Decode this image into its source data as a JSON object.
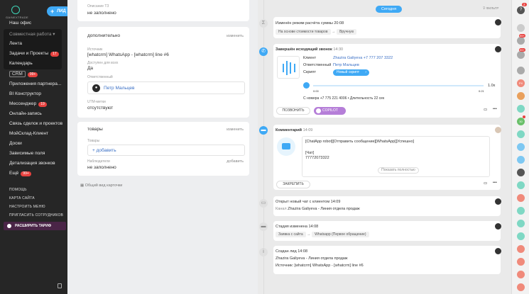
{
  "sidebar": {
    "brand": "GAINEXTRADE",
    "lead_button": "ЛИД",
    "collapse_icon": "collapse-icon",
    "items": [
      {
        "label": "Наш офис"
      },
      {
        "label": "Совместная работа",
        "badge": ""
      },
      {
        "label": "Лента"
      },
      {
        "label": "Задачи и Проекты",
        "badge": "17"
      },
      {
        "label": "Календарь"
      },
      {
        "label": "CRM",
        "badge": "99+"
      },
      {
        "label": "Приложения партнера..."
      },
      {
        "label": "BI Конструктор"
      },
      {
        "label": "Мессенджер",
        "badge": "19"
      },
      {
        "label": "Онлайн-запись"
      },
      {
        "label": "Связь сделок и проектов"
      },
      {
        "label": "МойСклад-Клиент"
      },
      {
        "label": "Доски"
      },
      {
        "label": "Зависимые поля"
      },
      {
        "label": "Детализация звонков"
      },
      {
        "label": "Ещё",
        "badge": "99+"
      }
    ],
    "small_links": [
      "ПОМОЩЬ",
      "КАРТА САЙТА",
      "НАСТРОИТЬ МЕНЮ",
      "ПРИГЛАСИТЬ СОТРУДНИКОВ"
    ],
    "tariff": "РАСШИРИТЬ ТАРИФ"
  },
  "left": {
    "tz_label": "Описание ТЗ",
    "tz_value": "не заполнено",
    "additional": "дополнительно",
    "change": "изменить",
    "source_label": "Источник",
    "source_value": "[whatcrm] WhatsApp - [whatcrm] line #6",
    "available_label": "Доступен для всех",
    "available_value": "Да",
    "responsible_label": "Ответственный",
    "responsible_name": "Петр Мальцев",
    "utm_label": "UTM-метки",
    "utm_value": "отсутствуют",
    "goods": "товары",
    "goods_change": "изменить",
    "goods_label": "Товары",
    "goods_add": "+ добавить",
    "observers_label": "Наблюдатели",
    "observers_add": "добавить",
    "observers_value": "не заполнено",
    "shared_view": "Общий вид карточки"
  },
  "feed": {
    "today": "Сегодня",
    "filter": "ФИЛЬТР",
    "e1": {
      "title": "Изменён режим расчёта суммы",
      "time": "20:08",
      "from": "На основе стоимости товаров",
      "to": "Вручную"
    },
    "call": {
      "title": "Завершён исходящий звонок",
      "time": "14:30",
      "client_label": "Клиент",
      "client_value": "Zhazira Galiyeva +7 777 207 3322",
      "responsible_label": "Ответственный",
      "responsible_value": "Петр Мальцев",
      "script_label": "Скрипт",
      "script_btn": "Новый скрипт",
      "t_start": "0:00",
      "t_end": "0:21",
      "speed": "1.0x",
      "meta": "С номера +7 775 221 4006 • Длительность 22 сек",
      "call_btn": "ПОЗВОНИТЬ",
      "copilot_btn": "COPILOT"
    },
    "comment": {
      "title": "Комментарий",
      "time": "14:09",
      "line1": "[ChatApp robot][Отправить сообщение][WhatsApp][Успешно]",
      "line2": "[Чат]",
      "line3": "77772073322",
      "show_full": "Показать полностью",
      "pin": "ЗАКРЕПИТЬ"
    },
    "chat": {
      "title": "Открыт новый чат с клиентом",
      "time": "14:09",
      "label": "Канал",
      "value": "Zhazira Galiyeva - Линия отдела продаж"
    },
    "stage": {
      "title": "Стадия изменена",
      "time": "14:08",
      "from": "Заявка с сайта",
      "to": "Whatsapp (Первое обращение)"
    },
    "created": {
      "title": "Создан лид",
      "time": "14:08",
      "line1": "Zhazira Galiyeva - Линия отдела продаж",
      "line2": "Источник: [whatcrm] WhatsApp - [whatcrm] line #6"
    }
  },
  "rightbar": {
    "top_badge": "2",
    "badges": [
      "99+",
      "99+",
      "30"
    ],
    "chip_px": "PX",
    "chip_30": "30"
  },
  "colors": {
    "accent": "#3fa9f5",
    "sidebar": "#262626",
    "badge": "#e8423f"
  }
}
